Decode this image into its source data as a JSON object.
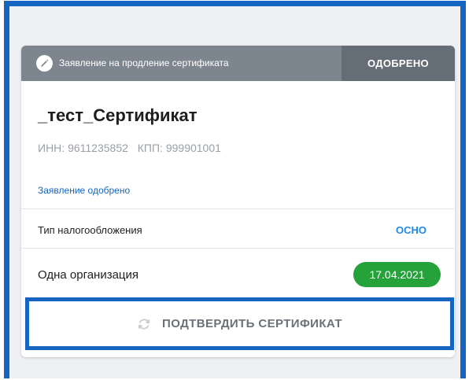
{
  "card": {
    "header": {
      "title": "Заявление на продление сертификата",
      "status": "ОДОБРЕНО",
      "edit_icon": "pencil-icon"
    },
    "cert_name": "_тест_Сертификат",
    "inn": "ИНН: 9611235852",
    "kpp": "КПП: 999901001",
    "status_link": "Заявление одобрено",
    "tax": {
      "label": "Тип налогообложения",
      "value": "ОСНО"
    },
    "org": {
      "label": "Одна организация",
      "date": "17.04.2021"
    }
  },
  "confirm_button": {
    "label": "ПОДТВЕРДИТЬ СЕРТИФИКАТ",
    "icon": "refresh-icon"
  },
  "colors": {
    "frame_border": "#1565c0",
    "header_bg": "#7d868f",
    "status_bg": "#656e77",
    "date_badge": "#25a33a",
    "link": "#1565c0"
  }
}
